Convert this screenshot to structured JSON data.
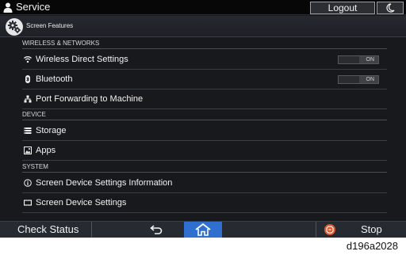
{
  "app": {
    "title": "Service"
  },
  "topbar": {
    "logout_label": "Logout",
    "night_mode_icon": "moon-icon"
  },
  "header": {
    "title": "Screen Features",
    "icon": "gear-icon"
  },
  "sections": {
    "wireless": {
      "title": "WIRELESS & NETWORKS",
      "items": [
        {
          "label": "Wireless Direct Settings",
          "icon": "wifi-icon",
          "toggle": "ON"
        },
        {
          "label": "Bluetooth",
          "icon": "bluetooth-icon",
          "toggle": "ON"
        },
        {
          "label": "Port Forwarding to Machine",
          "icon": "network-icon"
        }
      ]
    },
    "device": {
      "title": "DEVICE",
      "items": [
        {
          "label": "Storage",
          "icon": "storage-icon"
        },
        {
          "label": "Apps",
          "icon": "apps-icon"
        }
      ]
    },
    "system": {
      "title": "SYSTEM",
      "items": [
        {
          "label": "Screen Device Settings Information",
          "icon": "info-icon"
        },
        {
          "label": "Screen Device Settings",
          "icon": "display-icon"
        }
      ]
    }
  },
  "bottombar": {
    "check_status_label": "Check Status",
    "back_icon": "back-arrow-icon",
    "home_icon": "home-icon",
    "stop_label": "Stop",
    "colors": {
      "home_button": "#2f6fd0",
      "stop_icon": "#e2572a"
    }
  },
  "caption": "d196a2028"
}
